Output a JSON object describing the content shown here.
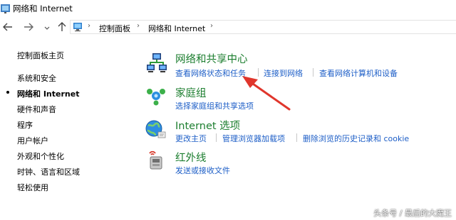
{
  "window": {
    "title": "网络和 Internet"
  },
  "navigation": {
    "back_icon": "arrow-left-icon",
    "forward_icon": "arrow-right-icon",
    "recent_icon": "chevron-down-icon",
    "up_icon": "arrow-up-icon",
    "breadcrumbs": [
      "控制面板",
      "网络和 Internet"
    ],
    "separator": "›"
  },
  "sidebar": {
    "home": "控制面板主页",
    "items": [
      "系统和安全",
      "网络和 Internet",
      "硬件和声音",
      "程序",
      "用户帐户",
      "外观和个性化",
      "时钟、语言和区域",
      "轻松使用"
    ],
    "current_index": 1
  },
  "categories": [
    {
      "title": "网络和共享中心",
      "icon": "network-center-icon",
      "links": [
        "查看网络状态和任务",
        "连接到网络",
        "查看网络计算机和设备"
      ]
    },
    {
      "title": "家庭组",
      "icon": "homegroup-icon",
      "links": [
        "选择家庭组和共享选项"
      ]
    },
    {
      "title": "Internet 选项",
      "icon": "internet-globe-icon",
      "links": [
        "更改主页",
        "管理浏览器加载项",
        "删除浏览的历史记录和 cookie"
      ]
    },
    {
      "title": "红外线",
      "icon": "infrared-icon",
      "links": [
        "发送或接收文件"
      ]
    }
  ],
  "annotation": {
    "arrow_color": "#e0362c"
  },
  "watermark": "头条号 / 最后的大魔王",
  "colors": {
    "category_title": "#1c7e2f",
    "link": "#1d5ec7"
  }
}
